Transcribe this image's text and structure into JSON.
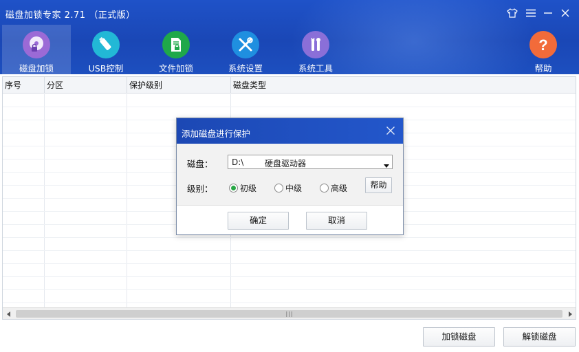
{
  "app": {
    "title": "磁盘加锁专家 2.71 （正式版）",
    "colors": {
      "header": "#1f52c8",
      "active_tab": "rgba(255,255,255,0.16)"
    }
  },
  "window_controls": [
    {
      "name": "skin-icon"
    },
    {
      "name": "menu-icon"
    },
    {
      "name": "minimize-icon"
    },
    {
      "name": "close-icon"
    }
  ],
  "nav": {
    "items": [
      {
        "label": "磁盘加锁",
        "icon": "disk-lock-icon",
        "color": "#9b6ad6",
        "active": true
      },
      {
        "label": "USB控制",
        "icon": "usb-icon",
        "color": "#22b8d6",
        "active": false
      },
      {
        "label": "文件加锁",
        "icon": "file-lock-icon",
        "color": "#1fa84a",
        "active": false
      },
      {
        "label": "系统设置",
        "icon": "tools-icon",
        "color": "#1f8fe0",
        "active": false
      },
      {
        "label": "系统工具",
        "icon": "toolbox-icon",
        "color": "#8a6fd8",
        "active": false
      }
    ],
    "help": {
      "label": "帮助",
      "icon": "help-icon",
      "color": "#f26b3a"
    }
  },
  "table": {
    "columns": [
      "序号",
      "分区",
      "保护级别",
      "磁盘类型"
    ],
    "rows": []
  },
  "buttons": {
    "lock": "加锁磁盘",
    "unlock": "解锁磁盘"
  },
  "dialog": {
    "title": "添加磁盘进行保护",
    "disk_label": "磁盘：",
    "disk_drive": "D:\\",
    "disk_type": "硬盘驱动器",
    "level_label": "级别：",
    "levels": [
      "初级",
      "中级",
      "高级"
    ],
    "selected_level": "初级",
    "help": "帮助",
    "ok": "确定",
    "cancel": "取消"
  }
}
